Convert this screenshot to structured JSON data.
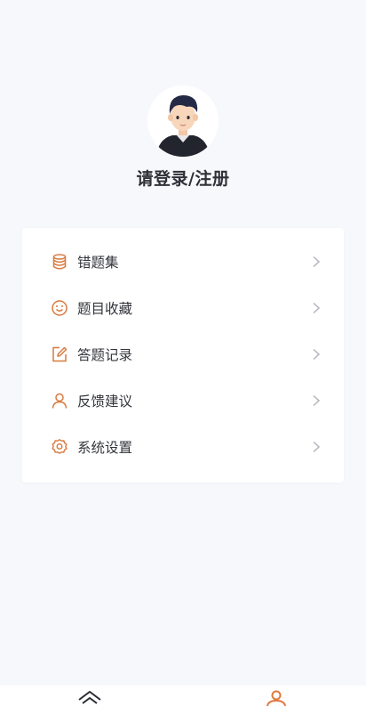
{
  "profile": {
    "login_text": "请登录/注册",
    "avatar_icon": "avatar-cartoon-boy"
  },
  "menu": {
    "items": [
      {
        "label": "错题集",
        "icon": "database-icon"
      },
      {
        "label": "题目收藏",
        "icon": "smile-icon"
      },
      {
        "label": "答题记录",
        "icon": "edit-icon"
      },
      {
        "label": "反馈建议",
        "icon": "user-icon"
      },
      {
        "label": "系统设置",
        "icon": "gear-icon"
      }
    ]
  },
  "tabbar": {
    "tabs": [
      {
        "icon": "home-icon",
        "active": false
      },
      {
        "icon": "person-icon",
        "active": true
      }
    ]
  },
  "colors": {
    "accent": "#e07a3e",
    "icon_orange": "#d87a40",
    "background": "#f7f8fc",
    "card": "#ffffff",
    "text": "#33353b",
    "chevron": "#b3b5bb"
  }
}
